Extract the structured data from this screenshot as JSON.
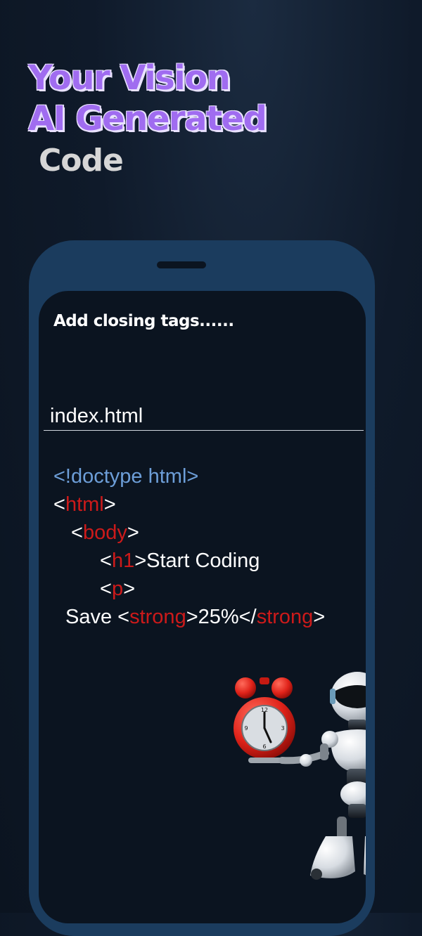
{
  "headline": {
    "line1": "Your Vision",
    "line2": "AI Generated",
    "line3": "Code"
  },
  "editor": {
    "task_text": "Add  closing tags......",
    "file_name": "index.html",
    "code": {
      "doctype": "<!doctype html>",
      "lt": "<",
      "gt": ">",
      "html_tag": "html",
      "body_tag": "body",
      "h1_tag": "h1",
      "h1_text": ">Start Coding",
      "p_tag": "p",
      "save_text": "Save <",
      "strong_tag": "strong",
      "pct_text": ">25%</",
      "strong_close_tag": "strong"
    }
  },
  "illustration": {
    "robot_icon": "robot-with-alarm-clock",
    "clock_numbers": [
      "12",
      "3",
      "6",
      "9"
    ]
  },
  "colors": {
    "accent_purple": "#a06cf0",
    "phone_frame": "#1b3c5e",
    "code_tag_red": "#cc1a1a",
    "code_doctype_blue": "#6d9ed8"
  }
}
